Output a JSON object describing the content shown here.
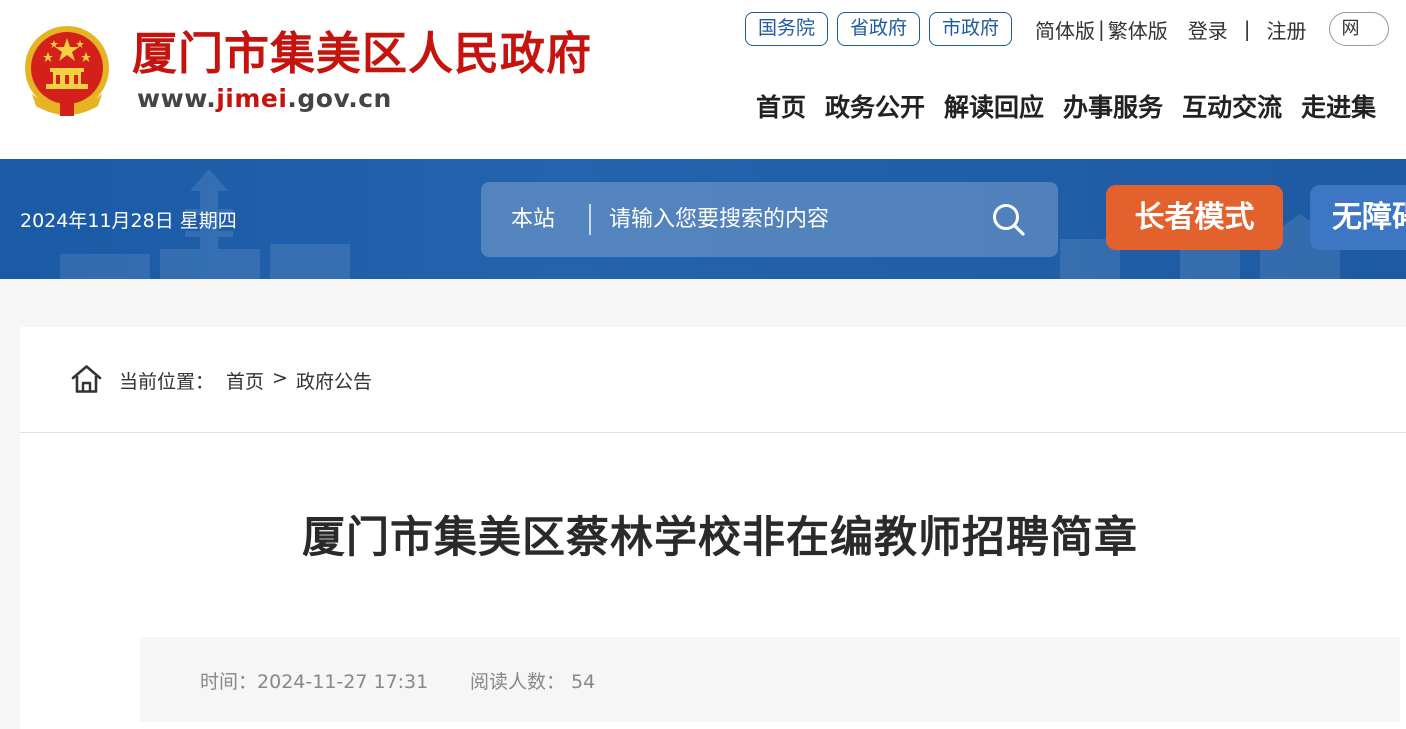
{
  "header": {
    "site_title": "厦门市集美区人民政府",
    "domain_prefix": "www.",
    "domain_highlight": "jimei",
    "domain_suffix": ".gov.cn",
    "gov_links": [
      "国务院",
      "省政府",
      "市政府"
    ],
    "lang_simplified": "简体版",
    "lang_separator": "|",
    "lang_traditional": "繁体版",
    "login": "登录",
    "auth_separator": "|",
    "register": "注册",
    "cut_pill": "网",
    "nav": [
      "首页",
      "政务公开",
      "解读回应",
      "办事服务",
      "互动交流",
      "走进集"
    ]
  },
  "banner": {
    "date": "2024年11月28日 星期四",
    "search_scope": "本站",
    "search_placeholder": "请输入您要搜索的内容",
    "elder_mode": "长者模式",
    "accessibility": "无障碍"
  },
  "breadcrumb": {
    "label": "当前位置：",
    "home": "首页",
    "arrow": ">",
    "current": "政府公告"
  },
  "article": {
    "title": "厦门市集美区蔡林学校非在编教师招聘简章",
    "time_label": "时间：",
    "time_value": "2024-11-27 17:31",
    "reads_label": "阅读人数：",
    "reads_value": "54"
  },
  "colors": {
    "brand_red": "#c5140e",
    "banner_blue": "#1a5aa6",
    "elder_orange": "#e2612d",
    "access_blue": "#3d77c4",
    "pill_blue": "#1d5a9f"
  }
}
